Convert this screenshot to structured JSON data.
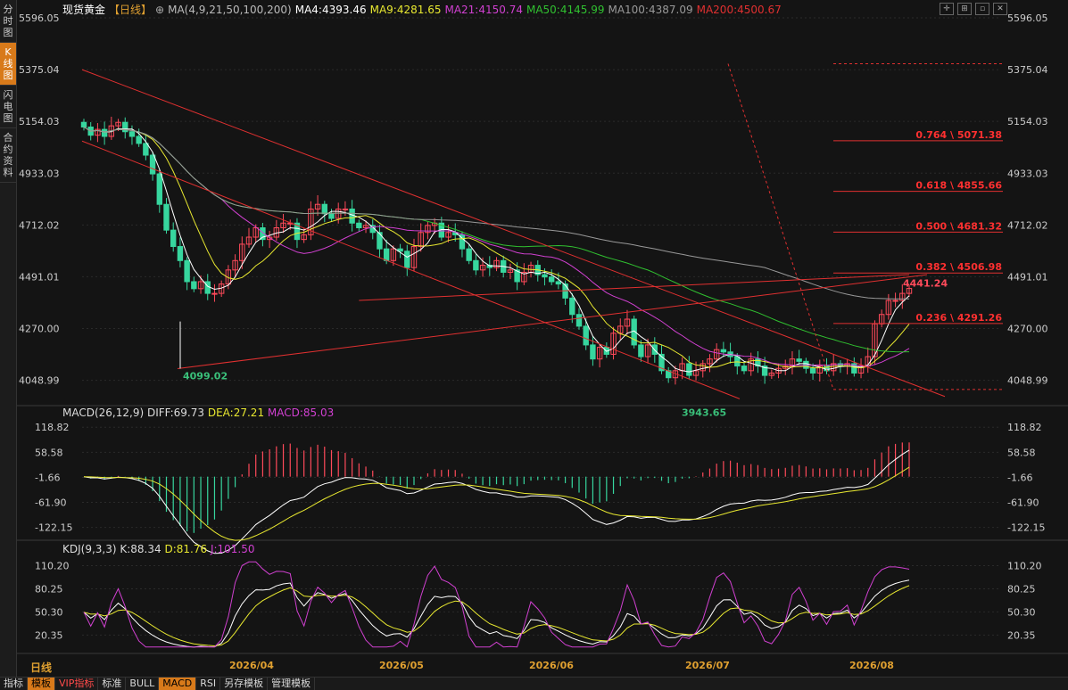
{
  "sidebar": [
    "分时图",
    "K线图",
    "闪电图",
    "合约资料"
  ],
  "header": {
    "symbol": "现货黄金",
    "period": "【日线】",
    "ma_params": "MA(4,9,21,50,100,200)",
    "ma4": "MA4:4393.46",
    "ma9": "MA9:4281.65",
    "ma21": "MA21:4150.74",
    "ma50": "MA50:4145.99",
    "ma100": "MA100:4387.09",
    "ma200": "MA200:4500.67"
  },
  "macd_header": {
    "label": "MACD(26,12,9)",
    "diff": "DIFF:69.73",
    "dea": "DEA:27.21",
    "macd": "MACD:85.03"
  },
  "kdj_header": {
    "label": "KDJ(9,3,3)",
    "k": "K:88.34",
    "d": "D:81.76",
    "j": "J:101.50"
  },
  "period_label": "日线",
  "bottom_tabs": [
    "指标",
    "模板",
    "VIP指标",
    "标准",
    "BULL",
    "MACD",
    "RSI",
    "另存模板",
    "管理模板"
  ],
  "colors": {
    "up": "#ff4a5a",
    "down": "#37d69e",
    "ma4": "#ffffff",
    "ma9": "#e8e830",
    "ma21": "#d040d0",
    "ma50": "#30c030",
    "ma100": "#999999",
    "ma200": "#e03030"
  },
  "chart_data": [
    {
      "type": "candlestick",
      "title": "现货黄金【日线】",
      "x_labels": [
        "2026/04",
        "2026/05",
        "2026/06",
        "2026/07",
        "2026/08"
      ],
      "y_ticks": [
        "5596.05",
        "5375.04",
        "5154.03",
        "4933.03",
        "4712.02",
        "4491.01",
        "4270.00",
        "4048.99"
      ],
      "ylim": [
        3960,
        5596.05
      ],
      "close": [
        5130,
        5095,
        5120,
        5090,
        5135,
        5150,
        5110,
        5090,
        5060,
        5010,
        4930,
        4800,
        4690,
        4620,
        4560,
        4470,
        4440,
        4470,
        4420,
        4420,
        4460,
        4520,
        4560,
        4630,
        4660,
        4700,
        4650,
        4660,
        4700,
        4720,
        4720,
        4650,
        4670,
        4780,
        4800,
        4760,
        4740,
        4780,
        4780,
        4720,
        4700,
        4710,
        4680,
        4610,
        4560,
        4610,
        4600,
        4530,
        4620,
        4680,
        4710,
        4720,
        4660,
        4680,
        4670,
        4610,
        4560,
        4520,
        4540,
        4530,
        4560,
        4510,
        4520,
        4470,
        4510,
        4540,
        4500,
        4490,
        4470,
        4460,
        4400,
        4330,
        4280,
        4200,
        4140,
        4190,
        4160,
        4250,
        4280,
        4310,
        4200,
        4150,
        4200,
        4160,
        4090,
        4060,
        4090,
        4120,
        4070,
        4090,
        4120,
        4140,
        4180,
        4170,
        4150,
        4110,
        4090,
        4140,
        4110,
        4070,
        4080,
        4100,
        4110,
        4140,
        4130,
        4100,
        4080,
        4110,
        4090,
        4120,
        4110,
        4120,
        4080,
        4110,
        4150,
        4290,
        4330,
        4390,
        4390,
        4420,
        4441
      ],
      "lows_annotated": [
        {
          "label": "4099.02"
        },
        {
          "label": "3943.65"
        }
      ],
      "highs_annotated": [
        {
          "label": "4441.24"
        }
      ],
      "fibonacci": [
        {
          "level": "0.764",
          "price": "5071.38"
        },
        {
          "level": "0.618",
          "price": "4855.66"
        },
        {
          "level": "0.500",
          "price": "4681.32"
        },
        {
          "level": "0.382",
          "price": "4506.98"
        },
        {
          "level": "0.236",
          "price": "4291.26"
        }
      ]
    },
    {
      "type": "bar",
      "title": "MACD(26,12,9)",
      "y_ticks": [
        "118.82",
        "58.58",
        "-1.66",
        "-61.90",
        "-122.15"
      ],
      "ylim": [
        -140,
        130
      ]
    },
    {
      "type": "line",
      "title": "KDJ(9,3,3)",
      "y_ticks": [
        "110.20",
        "80.25",
        "50.30",
        "20.35"
      ],
      "ylim": [
        0,
        120
      ]
    }
  ]
}
